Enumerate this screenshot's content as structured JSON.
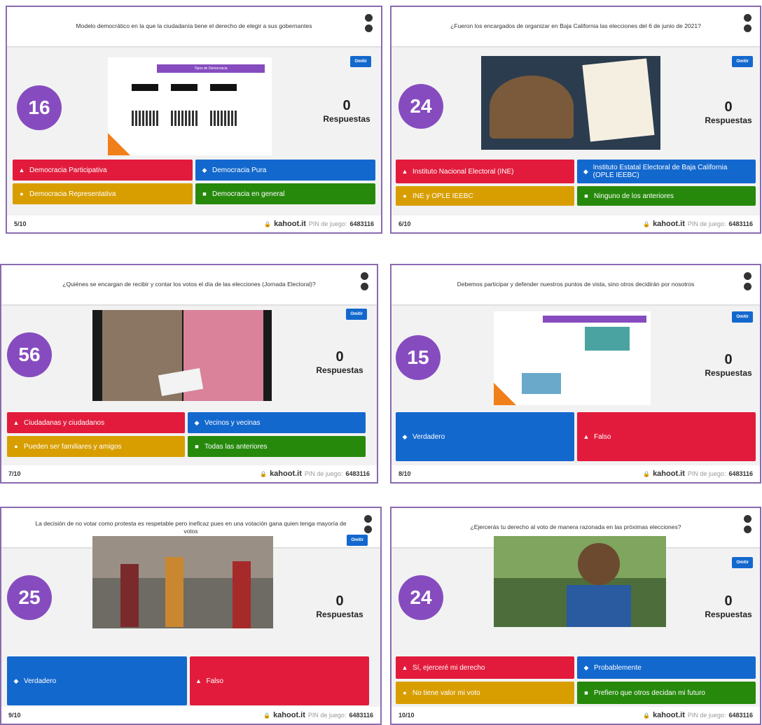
{
  "brand": {
    "site": "kahoot.it",
    "pin_label": "PIN de juego:",
    "pin": "6483116"
  },
  "common": {
    "skip_label": "Omitir",
    "responses_count": "0",
    "responses_label": "Respuestas"
  },
  "cards": [
    {
      "question": "Modelo democrático en la que la ciudadanía tiene el derecho de elegir a sus gobernantes",
      "timer": "16",
      "progress": "5/10",
      "slide_title": "Tipos de Democracia",
      "answers": [
        {
          "shape": "▲",
          "label": "Democracia Participativa",
          "color": "red"
        },
        {
          "shape": "◆",
          "label": "Democracia Pura",
          "color": "blue"
        },
        {
          "shape": "●",
          "label": "Democracia Representativa",
          "color": "yellow"
        },
        {
          "shape": "■",
          "label": "Democracia en general",
          "color": "green"
        }
      ]
    },
    {
      "question": "¿Fueron los encargados de organizar en Baja California las elecciones del 6 de junio de 2021?",
      "timer": "24",
      "progress": "6/10",
      "answers": [
        {
          "shape": "▲",
          "label": "Instituto Nacional Electoral (INE)",
          "color": "red"
        },
        {
          "shape": "◆",
          "label": "Instituto Estatal Electoral de Baja California (OPLE IEEBC)",
          "color": "blue"
        },
        {
          "shape": "●",
          "label": "INE y OPLE IEEBC",
          "color": "yellow"
        },
        {
          "shape": "■",
          "label": "Ninguno de los anteriores",
          "color": "green"
        }
      ]
    },
    {
      "question": "¿Quiénes se encargan de recibir y contar los votos el día de las elecciones (Jornada Electoral)?",
      "timer": "56",
      "progress": "7/10",
      "answers": [
        {
          "shape": "▲",
          "label": "Ciudadanas y ciudadanos",
          "color": "red"
        },
        {
          "shape": "◆",
          "label": "Vecinos y vecinas",
          "color": "blue"
        },
        {
          "shape": "●",
          "label": "Pueden ser familiares y amigos",
          "color": "yellow"
        },
        {
          "shape": "■",
          "label": "Todas las anteriores",
          "color": "green"
        }
      ]
    },
    {
      "question": "Debemos participar y defender nuestros puntos de vista, sino otros decidirán por nosotros",
      "timer": "15",
      "progress": "8/10",
      "answers": [
        {
          "shape": "◆",
          "label": "Verdadero",
          "color": "blue"
        },
        {
          "shape": "▲",
          "label": "Falso",
          "color": "red"
        }
      ]
    },
    {
      "question": "La decisión de no votar como protesta es respetable pero ineficaz pues en una votación gana quien tenga mayoría de votos",
      "timer": "25",
      "progress": "9/10",
      "answers": [
        {
          "shape": "◆",
          "label": "Verdadero",
          "color": "blue"
        },
        {
          "shape": "▲",
          "label": "Falso",
          "color": "red"
        }
      ]
    },
    {
      "question": "¿Ejercerás tu derecho al voto de manera razonada en las próximas elecciones?",
      "timer": "24",
      "progress": "10/10",
      "answers": [
        {
          "shape": "▲",
          "label": "Sí, ejerceré mi derecho",
          "color": "red"
        },
        {
          "shape": "◆",
          "label": "Probablemente",
          "color": "blue"
        },
        {
          "shape": "●",
          "label": "No tiene valor mi voto",
          "color": "yellow"
        },
        {
          "shape": "■",
          "label": "Prefiero que otros decidan mi futuro",
          "color": "green"
        }
      ]
    }
  ],
  "colors": {
    "purple": "#864cbf",
    "red": "#e21b3c",
    "blue": "#1368ce",
    "yellow": "#d89e00",
    "green": "#26890c"
  }
}
